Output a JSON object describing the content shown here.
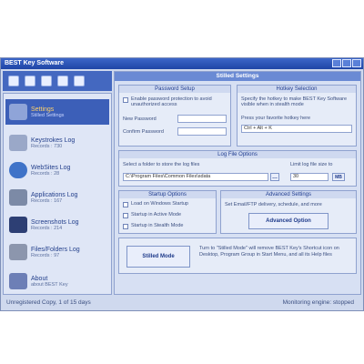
{
  "window": {
    "title": "BEST Key Software",
    "main_header": "Stilled Settings"
  },
  "sidebar": {
    "items": [
      {
        "title": "Settings",
        "sub": "Stilled Settings"
      },
      {
        "title": "Keystrokes Log",
        "sub": "Records : 730"
      },
      {
        "title": "WebSites Log",
        "sub": "Records : 28"
      },
      {
        "title": "Applications Log",
        "sub": "Records : 167"
      },
      {
        "title": "Screenshots Log",
        "sub": "Records : 214"
      },
      {
        "title": "Files/Folders Log",
        "sub": "Records : 97"
      },
      {
        "title": "About",
        "sub": "about BEST Key"
      }
    ]
  },
  "password_setup": {
    "title": "Password Setup",
    "checkbox_label": "Enable password protection to avoid unauthorized access",
    "new_password_label": "New Password",
    "confirm_password_label": "Confirm Password"
  },
  "hotkey": {
    "title": "Hotkey Selection",
    "desc": "Specify the hotkey to make BEST Key Software visible when in stealth mode",
    "prompt": "Press your favorite hotkey here",
    "value": "Ctrl + Alt + K"
  },
  "log_file": {
    "title": "Log File Options",
    "folder_label": "Select a folder to store the log files",
    "folder_value": "C:\\Program Files\\Common Files\\sdata",
    "limit_label": "Limit log file size to",
    "limit_value": "30",
    "limit_unit": "MB"
  },
  "startup": {
    "title": "Startup Options",
    "opt1": "Load on Windows Startup",
    "opt2": "Startup in Active Mode",
    "opt3": "Startup in Stealth Mode"
  },
  "advanced": {
    "title": "Advanced Settings",
    "desc": "Set Email/FTP delivery, schedule, and more",
    "button": "Advanced Option"
  },
  "stealth": {
    "button": "Stilled Mode",
    "desc": "Turn to \"Stilled Mode\" will remove BEST Key's Shortcut icon on Desktop, Program Group in Start Menu, and all its Help files"
  },
  "status": {
    "left": "Unregistered Copy, 1 of 15 days",
    "right": "Monitoring engine: stopped"
  },
  "colors": {
    "titlebar": "#2b52b6",
    "accent": "#3c5fb8",
    "panel": "#d7e0f3"
  }
}
